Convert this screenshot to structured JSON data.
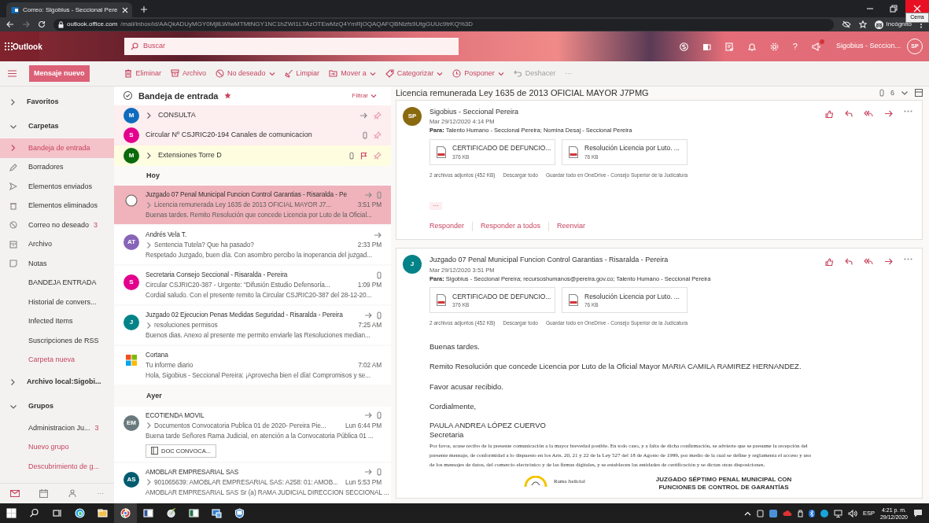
{
  "browser": {
    "tab_title": "Correo: Sigobius - Seccional Pere",
    "url_host": "outlook.office.com",
    "url_path": "/mail/inbox/id/AAQkADUyMGY0MjllLWIwMTMtNGY1NC1hZWI1LTAzOTEwMzQ4YmRjOQAQAFQBNlzfs9UtgGUUc9trKQ%3D",
    "profile": "Incógnito",
    "tooltip": "Cerra"
  },
  "header": {
    "app": "Outlook",
    "search_placeholder": "Buscar",
    "help": "?",
    "user": "Sigobius - Seccion...",
    "initials": "SP"
  },
  "commands": {
    "new_message": "Mensaje nuevo",
    "actions": [
      {
        "kind": "delete",
        "label": "Eliminar",
        "dropdown": false,
        "disabled": false
      },
      {
        "kind": "archive",
        "label": "Archivo",
        "dropdown": false,
        "disabled": false
      },
      {
        "kind": "junk",
        "label": "No deseado",
        "dropdown": true,
        "disabled": false
      },
      {
        "kind": "sweep",
        "label": "Limpiar",
        "dropdown": false,
        "disabled": false
      },
      {
        "kind": "move",
        "label": "Mover a",
        "dropdown": true,
        "disabled": false
      },
      {
        "kind": "categorize",
        "label": "Categorizar",
        "dropdown": true,
        "disabled": false
      },
      {
        "kind": "snooze",
        "label": "Posponer",
        "dropdown": true,
        "disabled": false
      },
      {
        "kind": "undo",
        "label": "Deshacer",
        "dropdown": false,
        "disabled": true
      }
    ],
    "more": "···"
  },
  "nav": {
    "items": [
      {
        "kind": "section",
        "label": "Favoritos",
        "expanded": false
      },
      {
        "kind": "section",
        "label": "Carpetas",
        "expanded": true
      },
      {
        "kind": "folder",
        "label": "Bandeja de entrada",
        "selected": true
      },
      {
        "kind": "folder",
        "label": "Borradores",
        "selected": false
      },
      {
        "kind": "folder",
        "label": "Elementos enviados",
        "selected": false
      },
      {
        "kind": "folder",
        "label": "Elementos eliminados",
        "selected": false
      },
      {
        "kind": "folder",
        "label": "Correo no deseado",
        "count": "3",
        "selected": false
      },
      {
        "kind": "folder",
        "label": "Archivo",
        "selected": false
      },
      {
        "kind": "folder",
        "label": "Notas",
        "selected": false
      },
      {
        "kind": "folder",
        "label": "BANDEJA ENTRADA",
        "selected": false
      },
      {
        "kind": "folder",
        "label": "Historial de convers...",
        "selected": false
      },
      {
        "kind": "folder",
        "label": "Infected Items",
        "selected": false
      },
      {
        "kind": "folder",
        "label": "Suscripciones de RSS",
        "selected": false
      },
      {
        "kind": "link",
        "label": "Carpeta nueva"
      },
      {
        "kind": "section",
        "label": "Archivo local:Sigobi...",
        "expanded": false
      },
      {
        "kind": "section",
        "label": "Grupos",
        "expanded": true
      },
      {
        "kind": "folder",
        "label": "Administracion Ju...",
        "count": "3",
        "selected": false
      },
      {
        "kind": "link",
        "label": "Nuevo grupo"
      },
      {
        "kind": "link",
        "label": "Descubrimiento de g..."
      }
    ],
    "more": "···"
  },
  "list": {
    "title": "Bandeja de entrada",
    "filter": "Filtrar",
    "items": [
      {
        "kind": "pinned",
        "initials": "M",
        "color": "#0f6cbd",
        "subject": "CONSULTA",
        "thread": true,
        "forwarded": true,
        "attachment": false,
        "flagged": false
      },
      {
        "kind": "pinned",
        "initials": "S",
        "color": "#e3008c",
        "subject": "Circular Nº CSJRIC20-194 Canales de comunicacion",
        "thread": false,
        "forwarded": false,
        "attachment": true,
        "flagged": false
      },
      {
        "kind": "pinned",
        "initials": "M",
        "color": "#0b6a0b",
        "subject": "Extensiones Torre D",
        "thread": true,
        "forwarded": false,
        "attachment": true,
        "flagged": true
      },
      {
        "kind": "heading",
        "label": "Hoy"
      },
      {
        "kind": "message",
        "sender": "Juzgado 07 Penal Municipal Funcion Control Garantias - Risaralda - Pe",
        "subject": "Licencia remunerada Ley 1635 de 2013 OFICIAL MAYOR J7...",
        "time": "3:51 PM",
        "preview": "Buenas tardes. Remito Resolución que concede Licencia por Luto de la Oficial...",
        "thread": true,
        "forwarded": true,
        "attachment": true,
        "selected": true
      },
      {
        "kind": "message",
        "initials": "AT",
        "color": "#8764b8",
        "sender": "Andrés Vela T.",
        "subject": "Sentencia Tutela? Que ha pasado?",
        "time": "2:33 PM",
        "preview": "Respetado Juzgado, buen día. Con asombro percibo la inoperancia del juzgad...",
        "thread": true,
        "forwarded": true,
        "attachment": false,
        "selected": false
      },
      {
        "kind": "message",
        "initials": "S",
        "color": "#e3008c",
        "sender": "Secretaria Consejo Seccional - Risaralda - Pereira",
        "subject": "Circular CSJRIC20-387 - Urgente: \"Difusión Estudio Defensoría...",
        "time": "1:09 PM",
        "preview": "Cordial saludo. Con el presente remito la Circular CSJRIC20-387 del 28-12-20...",
        "thread": false,
        "forwarded": false,
        "attachment": true,
        "selected": false
      },
      {
        "kind": "message",
        "initials": "J",
        "color": "#038387",
        "sender": "Juzgado 02 Ejecucion Penas Medidas Seguridad - Risaralda - Pereira",
        "subject": "resoluciones permisos",
        "time": "7:25 AM",
        "preview": "Buenos dias. Anexo al presente me permito enviarle las Resoluciones median...",
        "thread": true,
        "forwarded": true,
        "attachment": true,
        "selected": false
      },
      {
        "kind": "message",
        "sender": "Cortana",
        "subject": "Tu informe diario",
        "time": "7:02 AM",
        "preview": "Hola, Sigobius - Seccional Pereira: ¡Aprovecha bien el día! Compromisos y se...",
        "thread": false,
        "forwarded": false,
        "attachment": false,
        "selected": false
      },
      {
        "kind": "heading",
        "label": "Ayer"
      },
      {
        "kind": "message",
        "initials": "EM",
        "color": "#69797e",
        "sender": "ECOTIENDA MOVIL",
        "subject": "Documentos Convocatoria Publica 01 de 2020- Pereira Pie...",
        "time": "Lun 6:44 PM",
        "preview": "Buena tarde Señores Rama Judicial, en atención a la Convocatoria Pública 01 ...",
        "chip": "DOC CONVOCA...",
        "thread": true,
        "forwarded": true,
        "attachment": true,
        "selected": false
      },
      {
        "kind": "message",
        "initials": "AS",
        "color": "#005b70",
        "sender": "AMOBLAR EMPRESARIAL SAS",
        "subject": "901065639: AMOBLAR EMPRESARIAL SAS: A258: 01: AMOB...",
        "time": "Lun 5:53 PM",
        "preview": "AMOBLAR EMPRESARIAL SAS Sr (a) RAMA JUDICIAL DIRECCION SECCIONAL ...",
        "thread": true,
        "forwarded": true,
        "attachment": true,
        "selected": false
      }
    ]
  },
  "reading": {
    "subject": "Licencia remunerada Ley 1635 de 2013 OFICIAL MAYOR J7PMG",
    "attachment_count": "6",
    "messages": [
      {
        "initials": "SP",
        "color": "#8a6a0f",
        "sender": "Sigobius - Seccional Pereira",
        "date": "Mar 29/12/2020 4:14 PM",
        "to": "**Para:** Talento Humano - Seccional Pereira; Nomina Desaj - Seccional Pereira",
        "attachments": [
          {
            "name": "CERTIFICADO DE DEFUNCIO...",
            "size": "376 KB"
          },
          {
            "name": "Resolución Licencia por Luto. ...",
            "size": "76 KB"
          }
        ],
        "attachment_summary": "2 archivos adjuntos (452 KB)",
        "download_all": "Descargar todo",
        "save_all": "Guardar todo en OneDrive - Consejo Superior de la Judicatura",
        "show_more": "···",
        "replies": [
          "Responder",
          "Responder a todos",
          "Reenviar"
        ]
      },
      {
        "initials": "J",
        "color": "#038387",
        "sender": "Juzgado 07 Penal Municipal Funcion Control Garantias - Risaralda - Pereira",
        "date": "Mar 29/12/2020 3:51 PM",
        "to": "**Para:** Sigobius - Seccional Pereira; recursoshumanos@pereira.gov.co; Talento Humano - Seccional Pereira",
        "attachments": [
          {
            "name": "CERTIFICADO DE DEFUNCIO...",
            "size": "376 KB"
          },
          {
            "name": "Resolución Licencia por Luto. ...",
            "size": "76 KB"
          }
        ],
        "attachment_summary": "2 archivos adjuntos (452 KB)",
        "download_all": "Descargar todo",
        "save_all": "Guardar todo en OneDrive - Consejo Superior de la Judicatura",
        "body": [
          "Buenas tardes.",
          "Remito Resolución que concede Licencia por Luto de la Oficial Mayor MARIA CAMILA RAMIREZ HERNANDEZ.",
          "Favor acusar recibido.",
          "Cordialmente,"
        ],
        "signature": {
          "name": "PAULA ANDREA LÓPEZ CUERVO",
          "role": "Secretaria",
          "disclaimer": "Por favor, acuse recibo de la presente comunicación a la mayor brevedad posible. En todo caso, y a falta de dicha confirmación, se advierte que se presume la recepción del presente mensaje, de conformidad a lo dispuesto en los Arts. 20, 21 y 22 de la Ley 527 del 18 de Agosto de 1999, por medio de la cual se define y reglamenta el acceso y uso de los mensajes de datos, del comercio electrónico y de las firmas digitales, y se establecen las entidades de certificación y se dictan otras disposiciones.",
          "org": "Rama Judicial",
          "office": [
            "JUZGADO SÉPTIMO PENAL MUNICIPAL CON",
            "FUNCIONES DE CONTROL DE GARANTÍAS"
          ]
        }
      }
    ]
  },
  "taskbar": {
    "language": "ESP",
    "time": "4:21 p. m.",
    "date": "29/12/2020"
  }
}
